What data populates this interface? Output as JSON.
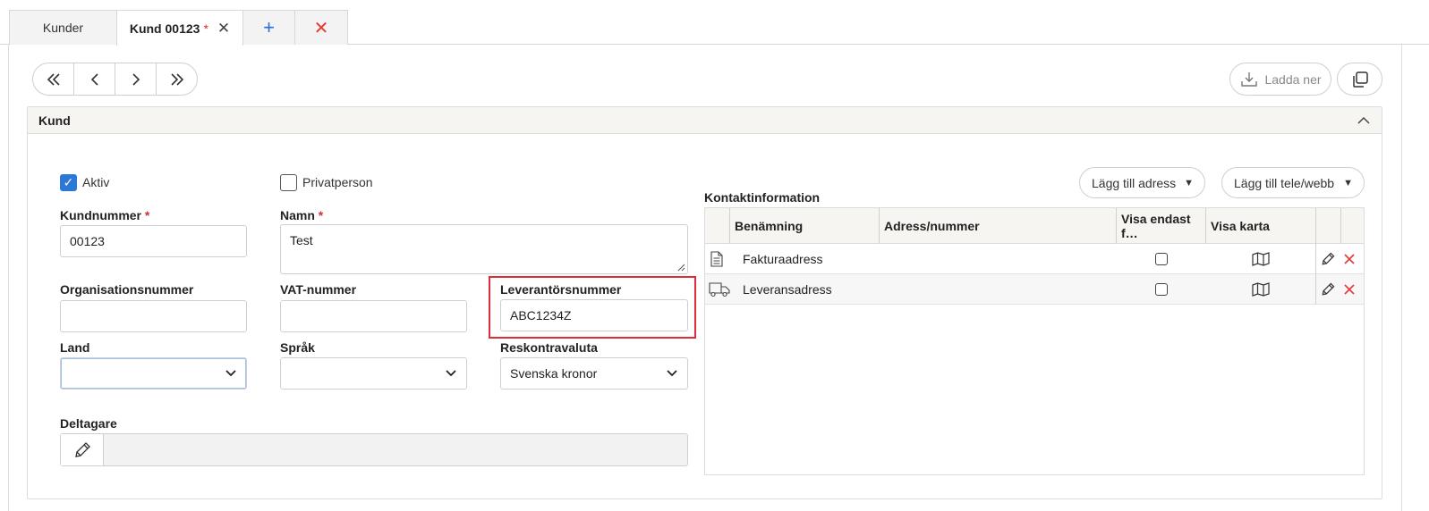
{
  "tabs": [
    {
      "label": "Kunder"
    },
    {
      "label": "Kund 00123",
      "modified_marker": "*",
      "close_glyph": "✕"
    },
    {
      "glyph": "+"
    },
    {
      "glyph": "✕"
    }
  ],
  "nav": {
    "first": "«",
    "prev": "‹",
    "next": "›",
    "last": "»"
  },
  "toolbar": {
    "download_label": "Ladda ner",
    "download_icon": "download-icon",
    "copy_icon": "copy-icon"
  },
  "section": {
    "title": "Kund",
    "collapse_glyph": "︿"
  },
  "form": {
    "active_label": "Aktiv",
    "private_label": "Privatperson",
    "customer_number_label": "Kundnummer",
    "customer_number_value": "00123",
    "name_label": "Namn",
    "name_value": "Test",
    "org_number_label": "Organisationsnummer",
    "org_number_value": "",
    "vat_label": "VAT-nummer",
    "vat_value": "",
    "supplier_number_label": "Leverantörsnummer",
    "supplier_number_value": "ABC1234Z",
    "country_label": "Land",
    "country_value": "",
    "language_label": "Språk",
    "language_value": "",
    "currency_label": "Reskontravaluta",
    "currency_value": "Svenska kronor",
    "participants_label": "Deltagare",
    "required_marker": "*"
  },
  "contact": {
    "title": "Kontaktinformation",
    "add_address_label": "Lägg till adress",
    "add_phone_label": "Lägg till tele/webb",
    "columns": [
      "Benämning",
      "Adress/nummer",
      "Visa endast f…",
      "Visa karta"
    ],
    "rows": [
      {
        "icon": "document-icon",
        "name": "Fakturaadress",
        "address": ""
      },
      {
        "icon": "truck-icon",
        "name": "Leveransadress",
        "address": ""
      }
    ]
  },
  "colors": {
    "accent": "#2b78d6",
    "required": "#d32f2f",
    "highlight": "#e02b3a",
    "header_bg": "#f6f5f2"
  }
}
